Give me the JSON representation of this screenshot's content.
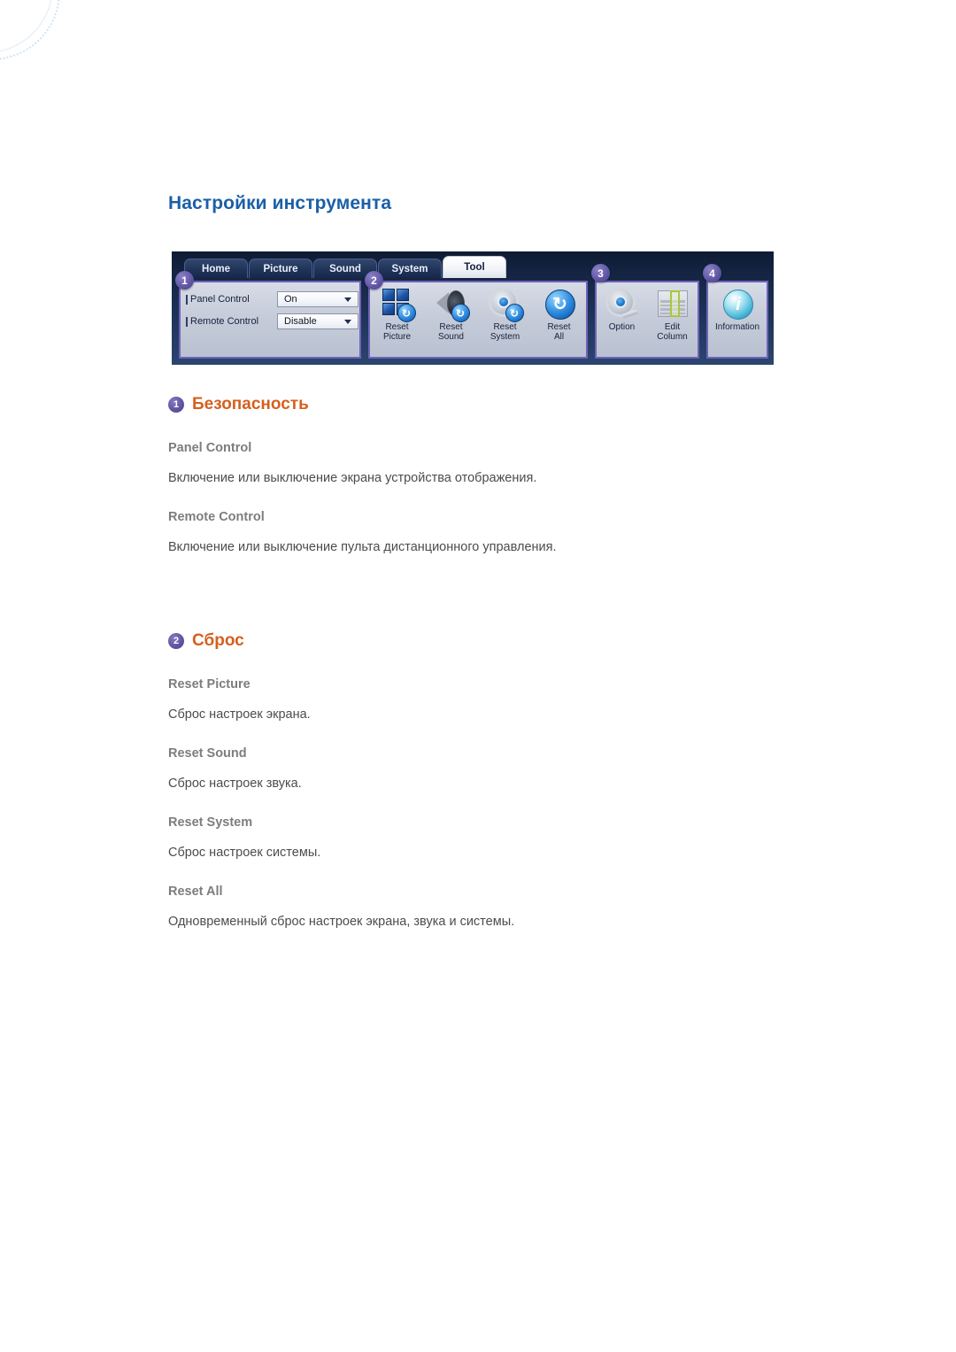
{
  "page": {
    "title": "Настройки инструмента"
  },
  "screenshot": {
    "name": "mdc-tool-tab-screenshot",
    "tabs": [
      {
        "label": "Home",
        "active": false
      },
      {
        "label": "Picture",
        "active": false
      },
      {
        "label": "Sound",
        "active": false
      },
      {
        "label": "System",
        "active": false
      },
      {
        "label": "Tool",
        "active": true
      }
    ],
    "callouts": [
      "1",
      "2",
      "3",
      "4"
    ],
    "group1": {
      "rows": [
        {
          "label": "Panel Control",
          "value": "On"
        },
        {
          "label": "Remote Control",
          "value": "Disable"
        }
      ]
    },
    "group2": {
      "buttons": [
        {
          "icon": "reset-picture-icon",
          "line1": "Reset",
          "line2": "Picture"
        },
        {
          "icon": "reset-sound-icon",
          "line1": "Reset",
          "line2": "Sound"
        },
        {
          "icon": "reset-system-icon",
          "line1": "Reset",
          "line2": "System"
        },
        {
          "icon": "reset-all-icon",
          "line1": "Reset",
          "line2": "All"
        }
      ]
    },
    "group3": {
      "buttons": [
        {
          "icon": "option-icon",
          "line1": "Option",
          "line2": ""
        },
        {
          "icon": "edit-column-icon",
          "line1": "Edit",
          "line2": "Column"
        }
      ]
    },
    "group4": {
      "buttons": [
        {
          "icon": "information-icon",
          "line1": "Information",
          "line2": ""
        }
      ]
    }
  },
  "sections": [
    {
      "number": "1",
      "title": "Безопасность",
      "items": [
        {
          "name": "Panel Control",
          "desc": "Включение или выключение экрана устройства отображения."
        },
        {
          "name": "Remote Control",
          "desc": "Включение или выключение пульта дистанционного управления."
        }
      ]
    },
    {
      "number": "2",
      "title": "Сброс",
      "items": [
        {
          "name": "Reset Picture",
          "desc": "Сброс настроек экрана."
        },
        {
          "name": "Reset Sound",
          "desc": "Сброс настроек звука."
        },
        {
          "name": "Reset System",
          "desc": "Сброс настроек системы."
        },
        {
          "name": "Reset All",
          "desc": "Одновременный сброс настроек экрана, звука и системы."
        }
      ]
    }
  ],
  "colors": {
    "title_blue": "#1a5fa8",
    "section_orange": "#d4601f",
    "badge_purple": "#5e539e",
    "group_border_purple": "#6f63b8",
    "item_name_gray": "#7d7d7d",
    "body_gray": "#4c4c4c"
  }
}
